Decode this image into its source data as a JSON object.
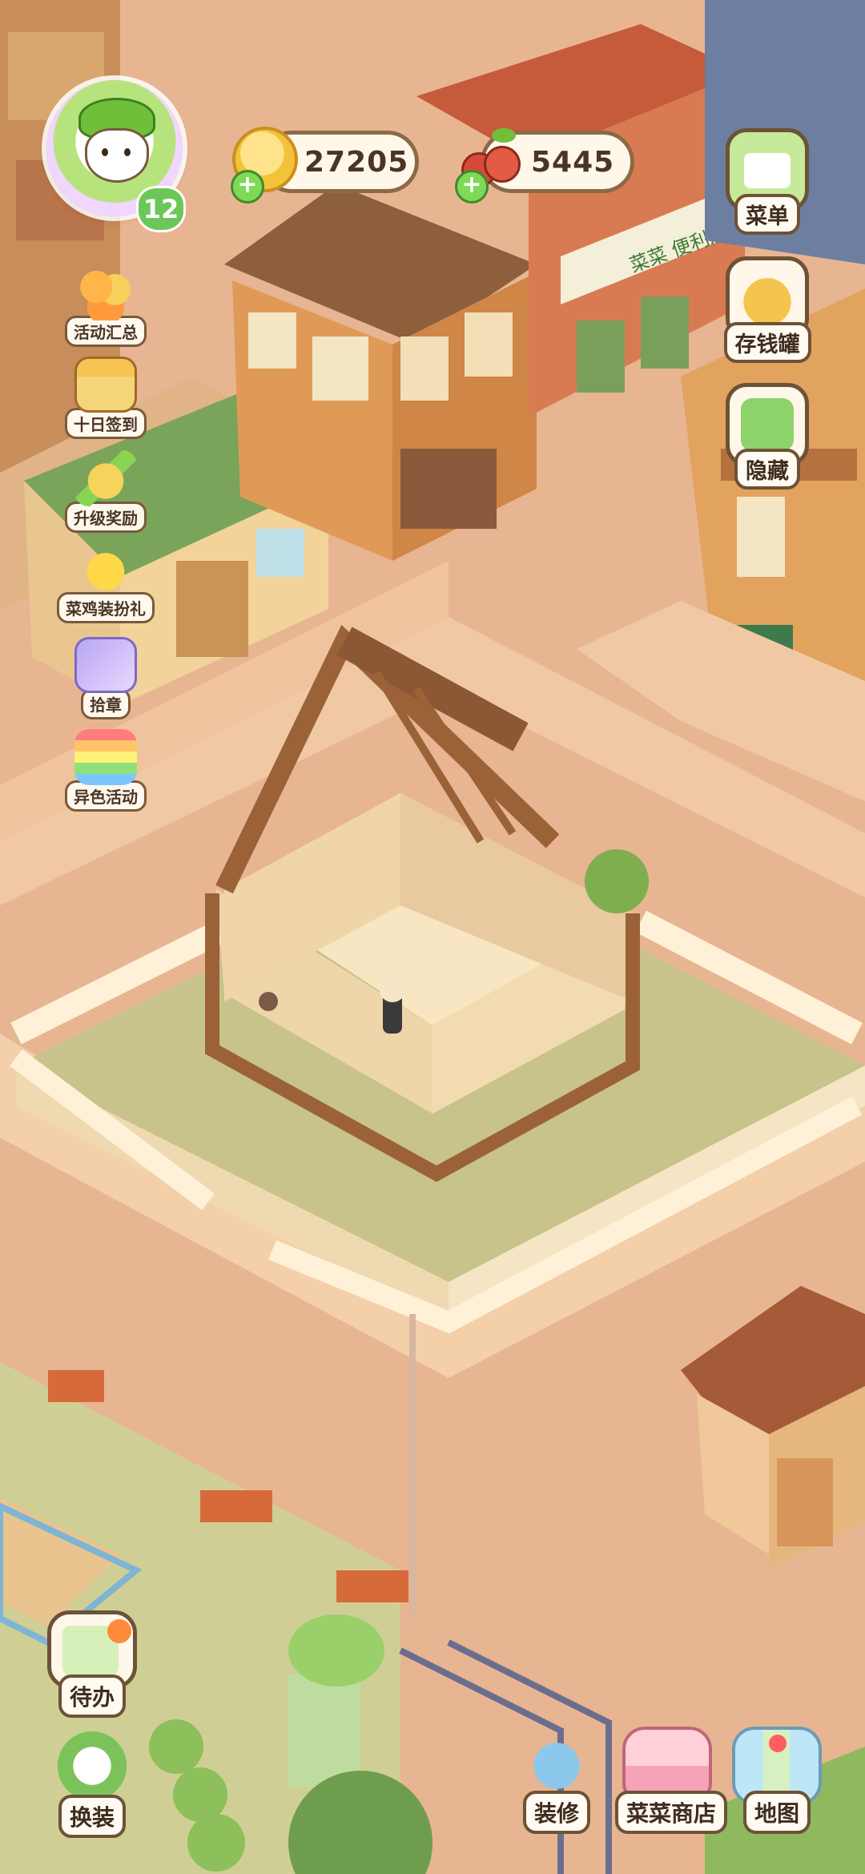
{
  "player": {
    "level": "12"
  },
  "currency": {
    "coins": {
      "value": "27205",
      "color": "#f2c33a"
    },
    "cherries": {
      "value": "5445",
      "color": "#d64a3a"
    }
  },
  "left_menu": [
    {
      "label": "活动汇总",
      "icon": "fruit-basket-icon"
    },
    {
      "label": "十日签到",
      "icon": "gift-box-icon"
    },
    {
      "label": "升级奖励",
      "icon": "level-up-arrow-icon"
    },
    {
      "label": "菜鸡装扮礼",
      "icon": "chick-icon"
    },
    {
      "label": "拾章",
      "icon": "badge-icon"
    },
    {
      "label": "异色活动",
      "icon": "rainbow-icon"
    }
  ],
  "right_menu": [
    {
      "label": "菜单",
      "icon": "tv-menu-icon"
    },
    {
      "label": "存钱罐",
      "icon": "piggy-bank-icon"
    },
    {
      "label": "隐藏",
      "icon": "hide-frame-icon"
    }
  ],
  "bottom_left": [
    {
      "label": "待办",
      "icon": "todo-list-icon"
    },
    {
      "label": "换装",
      "icon": "wardrobe-icon"
    }
  ],
  "bottom_right": [
    {
      "label": "装修",
      "icon": "decorate-bird-icon"
    },
    {
      "label": "菜菜商店",
      "icon": "shop-bag-icon"
    },
    {
      "label": "地图",
      "icon": "map-icon"
    }
  ],
  "scene": {
    "shop_sign": "菜菜 便利店"
  }
}
